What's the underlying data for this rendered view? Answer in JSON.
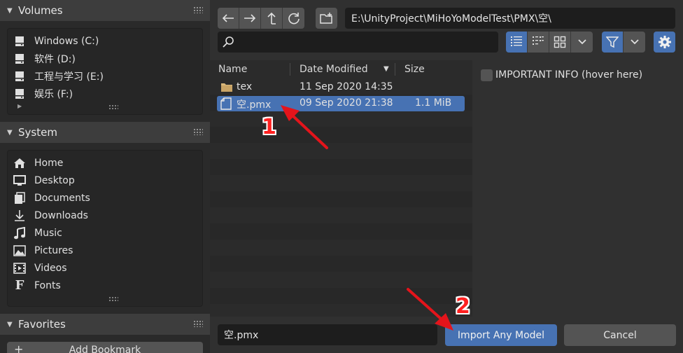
{
  "sidebar": {
    "volumes": {
      "title": "Volumes",
      "items": [
        {
          "label": "Windows (C:)",
          "icon": "drive-icon"
        },
        {
          "label": "软件 (D:)",
          "icon": "drive-icon"
        },
        {
          "label": "工程与学习 (E:)",
          "icon": "drive-icon"
        },
        {
          "label": "娱乐 (F:)",
          "icon": "drive-icon"
        }
      ]
    },
    "system": {
      "title": "System",
      "items": [
        {
          "label": "Home",
          "icon": "home-icon"
        },
        {
          "label": "Desktop",
          "icon": "desktop-icon"
        },
        {
          "label": "Documents",
          "icon": "documents-icon"
        },
        {
          "label": "Downloads",
          "icon": "downloads-icon"
        },
        {
          "label": "Music",
          "icon": "music-icon"
        },
        {
          "label": "Pictures",
          "icon": "pictures-icon"
        },
        {
          "label": "Videos",
          "icon": "videos-icon"
        },
        {
          "label": "Fonts",
          "icon": "fonts-icon"
        }
      ]
    },
    "favorites": {
      "title": "Favorites",
      "add_bookmark_label": "Add Bookmark",
      "add_icon_glyph": "+"
    }
  },
  "toolbar": {
    "path": "E:\\UnityProject\\MiHoYoModelTest\\PMX\\空\\",
    "search_value": ""
  },
  "filelist": {
    "columns": {
      "name": "Name",
      "date": "Date Modified",
      "size": "Size"
    },
    "rows": [
      {
        "name": "tex",
        "date": "11 Sep 2020 14:35",
        "size": "",
        "type": "folder",
        "selected": false
      },
      {
        "name": "空.pmx",
        "date": "09 Sep 2020 21:38",
        "size": "1.1 MiB",
        "type": "file",
        "selected": true
      }
    ]
  },
  "options": {
    "important_info_label": "IMPORTANT INFO (hover here)"
  },
  "bottom": {
    "filename_value": "空.pmx",
    "import_label": "Import Any Model",
    "cancel_label": "Cancel"
  },
  "annotations": {
    "step1": "1",
    "step2": "2"
  },
  "colors": {
    "accent": "#4772b3",
    "button": "#545454",
    "field": "#1d1d1d",
    "annotation": "#ff2020"
  }
}
